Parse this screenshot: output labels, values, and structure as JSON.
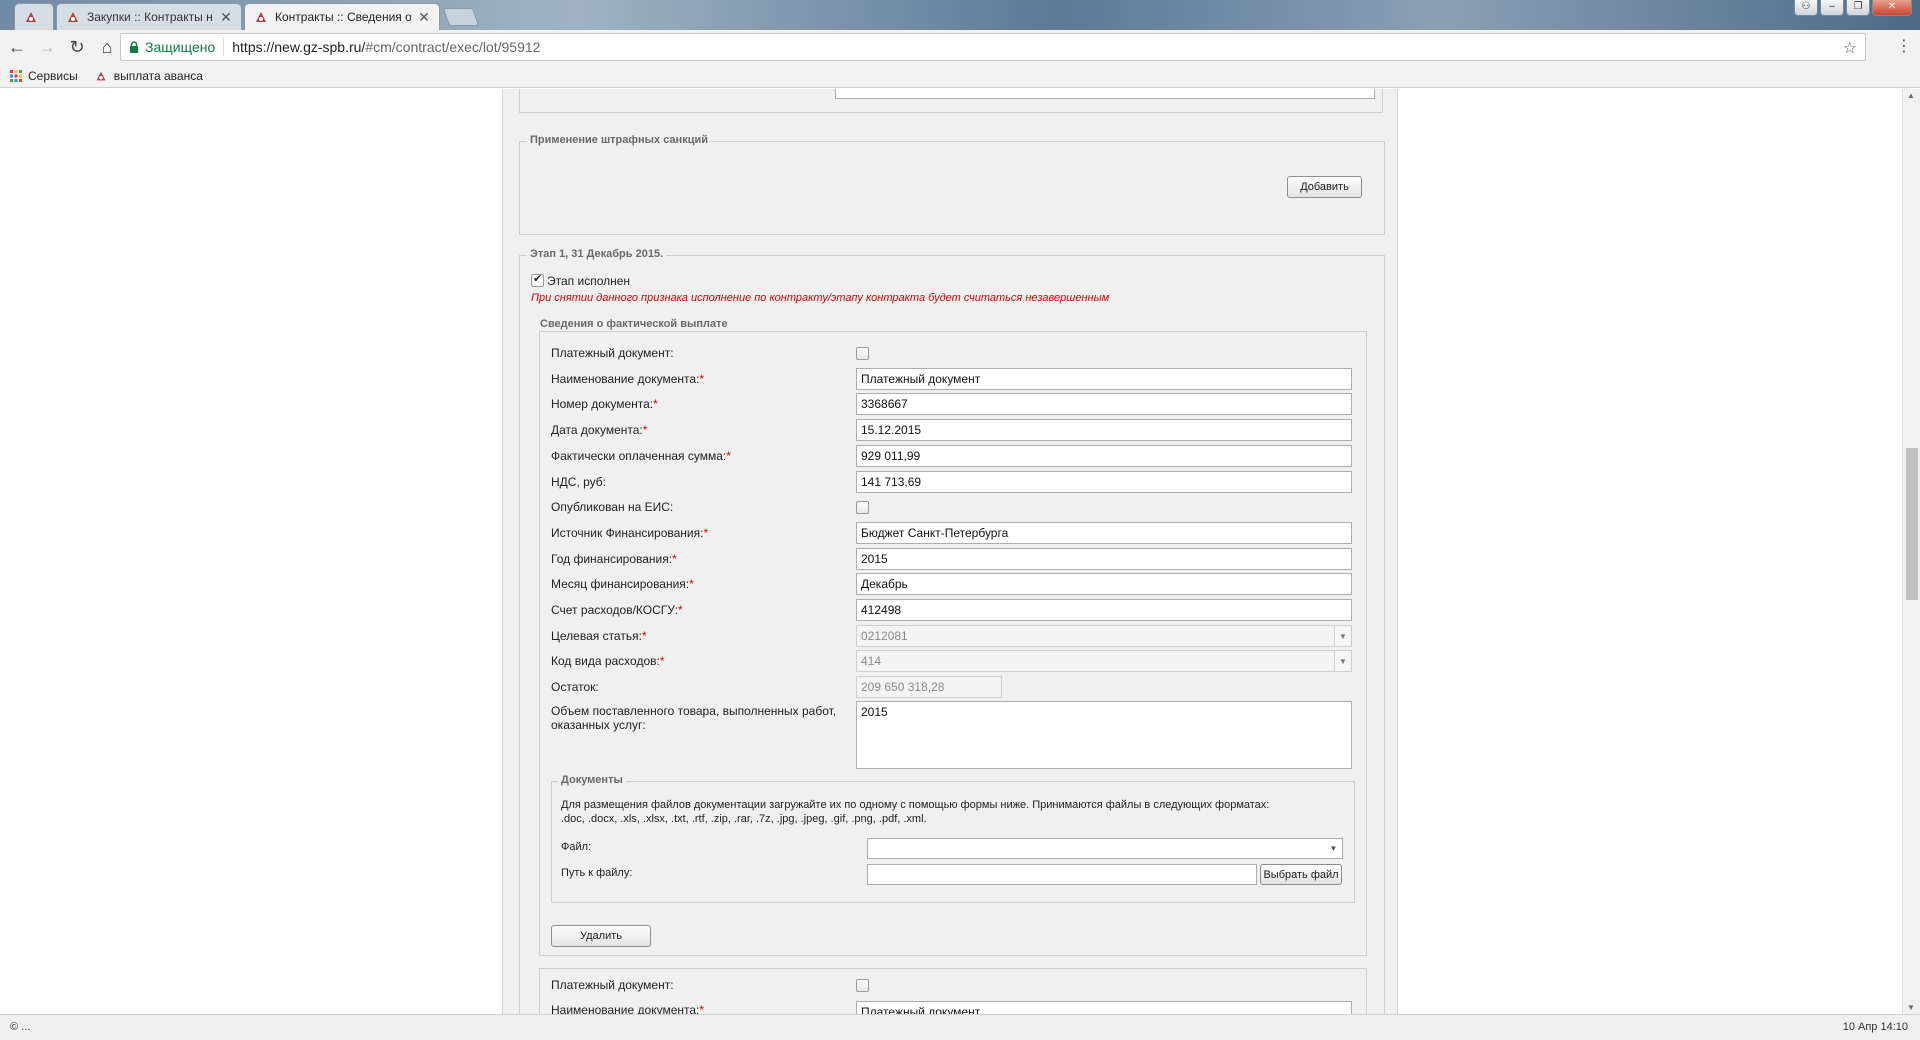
{
  "browser": {
    "tabs": [
      {
        "title": ""
      },
      {
        "title": "Закупки :: Контракты на"
      },
      {
        "title": "Контракты :: Сведения о"
      }
    ],
    "secure_label": "Защищено",
    "url_host": "https://new.gz-spb.ru/",
    "url_rest": "#cm/contract/exec/lot/95912",
    "bookmarks": [
      "Сервисы",
      "выплата аванса"
    ]
  },
  "penalties": {
    "legend": "Применение штрафных санкций",
    "add_label": "Добавить"
  },
  "stage": {
    "legend": "Этап 1, 31 Декабрь 2015.",
    "done_label": "Этап исполнен",
    "done_checked": true,
    "warning": "При снятии данного признака исполнение по контракту/этапу контракта будет считаться незавершенным",
    "payment_legend": "Сведения о фактической выплате"
  },
  "payment": {
    "fields": [
      {
        "label": "Платежный документ:",
        "required": false,
        "type": "checkbox",
        "checked": false
      },
      {
        "label": "Наименование документа:",
        "required": true,
        "type": "text",
        "value": "Платежный документ"
      },
      {
        "label": "Номер документа:",
        "required": true,
        "type": "text",
        "value": "3368667"
      },
      {
        "label": "Дата документа:",
        "required": true,
        "type": "text",
        "value": "15.12.2015"
      },
      {
        "label": "Фактически оплаченная сумма:",
        "required": true,
        "type": "text",
        "value": "929 011,99"
      },
      {
        "label": "НДС, руб:",
        "required": false,
        "type": "text",
        "value": "141 713,69"
      },
      {
        "label": "Опубликован на ЕИС:",
        "required": false,
        "type": "checkbox",
        "checked": false
      },
      {
        "label": "Источник Финансирования:",
        "required": true,
        "type": "text",
        "value": "Бюджет Санкт-Петербурга"
      },
      {
        "label": "Год финансирования:",
        "required": true,
        "type": "text",
        "value": "2015"
      },
      {
        "label": "Месяц финансирования:",
        "required": true,
        "type": "text",
        "value": "Декабрь"
      },
      {
        "label": "Счет расходов/КОСГУ:",
        "required": true,
        "type": "text",
        "value": "412498"
      },
      {
        "label": "Целевая статья:",
        "required": true,
        "type": "select-disabled",
        "value": "0212081"
      },
      {
        "label": "Код вида расходов:",
        "required": true,
        "type": "select-disabled",
        "value": "414"
      },
      {
        "label": "Остаток:",
        "required": false,
        "type": "text-disabled-short",
        "value": "209 650 318,28"
      }
    ],
    "volume_label_1": "Объем поставленного товара, выполненных работ,",
    "volume_label_2": "оказанных услуг:",
    "volume_value": "2015"
  },
  "documents": {
    "legend": "Документы",
    "info_line1": "Для размещения файлов документации загружайте их по одному с помощью формы ниже. Принимаются файлы в следующих форматах:",
    "info_line2": ".doc, .docx, .xls, .xlsx, .txt, .rtf, .zip, .rar, .7z, .jpg, .jpeg, .gif, .png, .pdf, .xml.",
    "file_label": "Файл:",
    "file_value": "",
    "path_label": "Путь к файлу:",
    "path_value": "",
    "choose_label": "Выбрать файл",
    "delete_label": "Удалить"
  },
  "next_payment": {
    "doc_label": "Платежный документ:",
    "name_label": "Наименование документа:",
    "name_value": "Платежный документ"
  },
  "status": {
    "left": "© ...",
    "right": "10 Апр 14:10"
  }
}
